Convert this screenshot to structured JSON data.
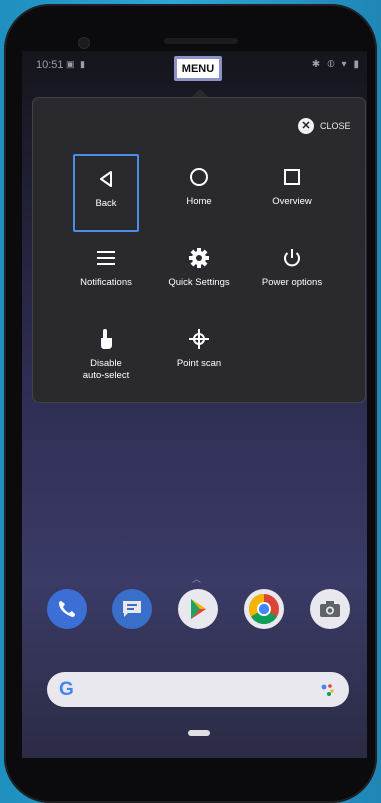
{
  "status_bar": {
    "time": "10:51"
  },
  "menu_label": "MENU",
  "close_label": "CLOSE",
  "tiles": [
    {
      "label": "Back",
      "icon": "back-triangle-icon"
    },
    {
      "label": "Home",
      "icon": "home-circle-icon"
    },
    {
      "label": "Overview",
      "icon": "overview-square-icon"
    },
    {
      "label": "Notifications",
      "icon": "notifications-menu-icon"
    },
    {
      "label": "Quick Settings",
      "icon": "gear-icon"
    },
    {
      "label": "Power options",
      "icon": "power-icon"
    },
    {
      "label": "Disable\nauto-select",
      "icon": "touch-hand-icon"
    },
    {
      "label": "Point scan",
      "icon": "crosshair-icon"
    }
  ],
  "dock_apps": [
    "phone-app-icon",
    "messages-app-icon",
    "play-store-app-icon",
    "chrome-app-icon",
    "camera-app-icon"
  ],
  "colors": {
    "selection": "#4a8ee6",
    "panel": "#2a2a2e",
    "menu_border": "#8b93c9"
  }
}
